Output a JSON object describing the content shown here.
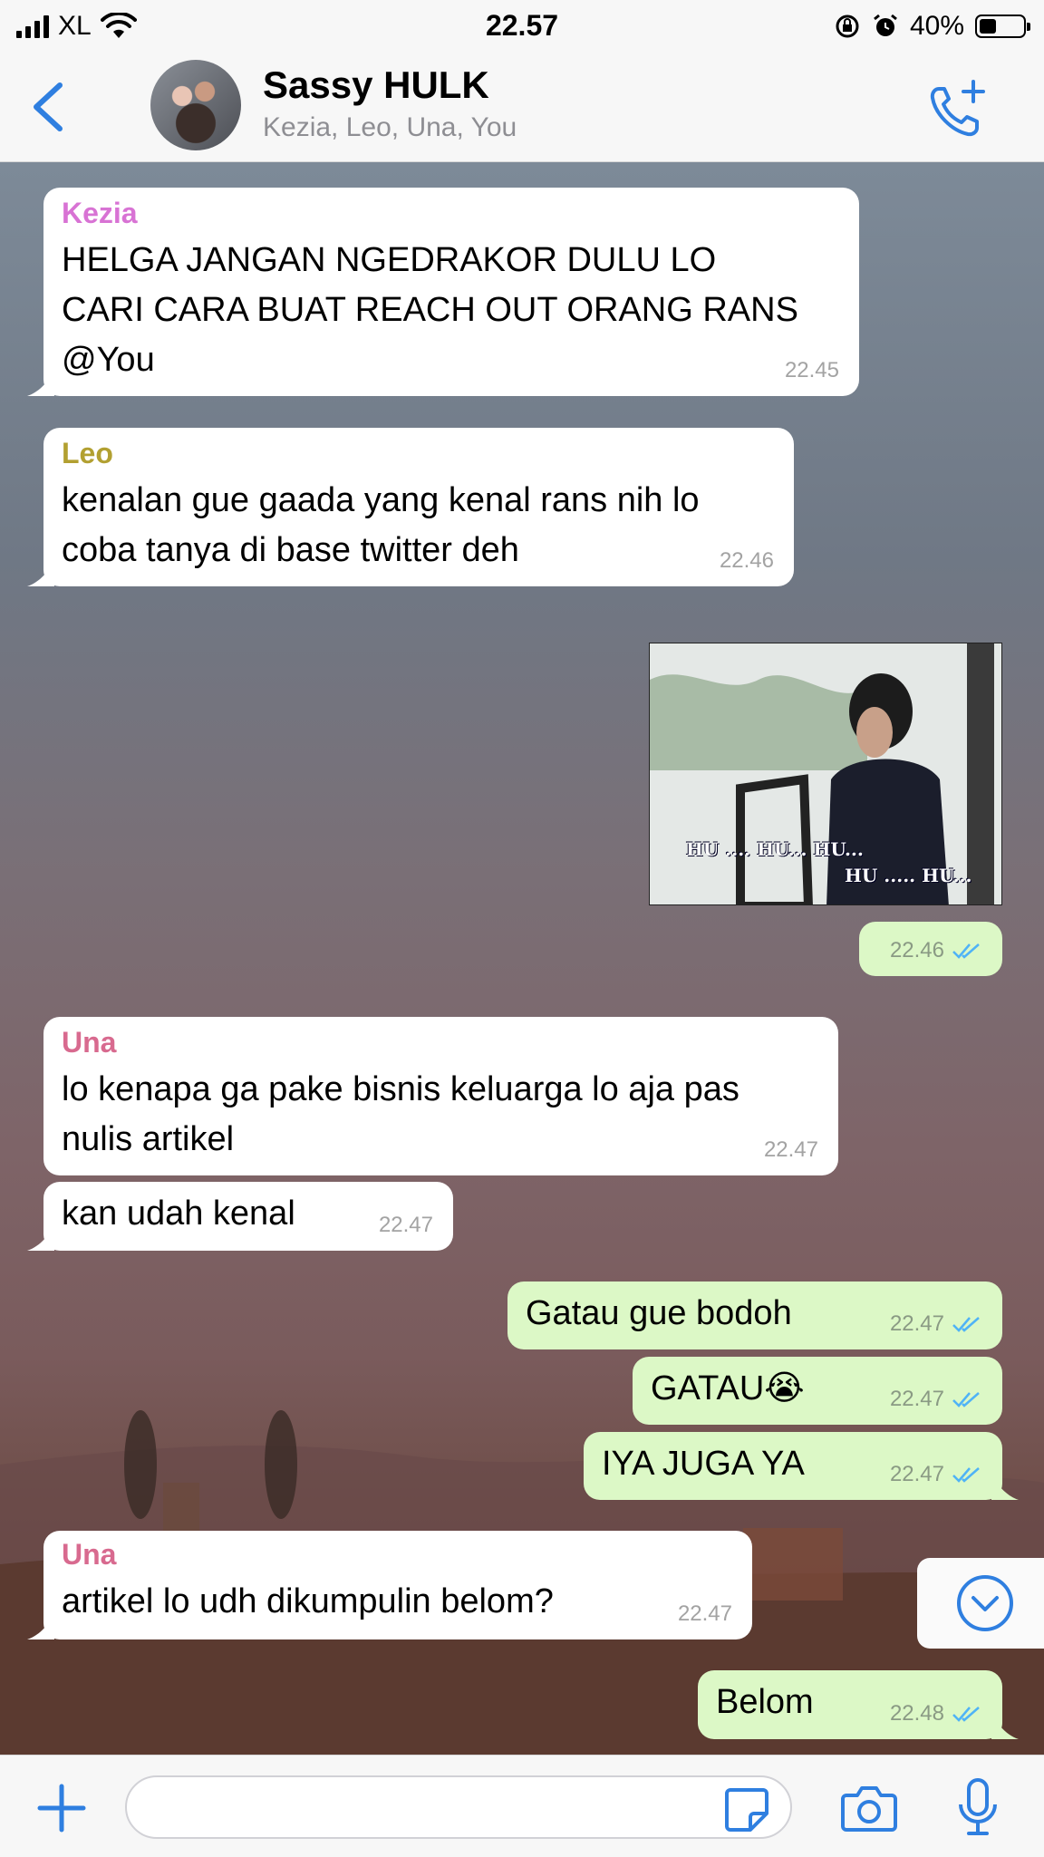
{
  "status_bar": {
    "carrier": "XL",
    "time": "22.57",
    "battery_percent": "40%",
    "battery_level": 0.4,
    "icons": [
      "signal-icon",
      "wifi-icon",
      "rotation-lock-icon",
      "alarm-icon",
      "battery-icon"
    ]
  },
  "header": {
    "title": "Sassy HULK",
    "subtitle": "Kezia, Leo, Una, You",
    "icons": [
      "back-chevron-icon",
      "group-avatar",
      "add-call-icon"
    ]
  },
  "messages": [
    {
      "sender": "Kezia",
      "sender_color": "#d873d4",
      "lines": [
        "HELGA JANGAN NGEDRAKOR DULU LO",
        "CARI CARA BUAT REACH OUT ORANG RANS",
        "@You"
      ],
      "time": "22.45"
    },
    {
      "sender": "Leo",
      "sender_color": "#b2a031",
      "lines": [
        "kenalan gue gaada yang kenal rans nih lo",
        "coba tanya di base twitter deh"
      ],
      "time": "22.46"
    },
    {
      "image_caption_1": "HU .... HU... HU...",
      "image_caption_2": "HU ..... HU...",
      "time": "22.46"
    },
    {
      "sender": "Una",
      "sender_color": "#d86a8f",
      "lines": [
        "lo kenapa ga pake bisnis keluarga lo aja pas",
        "nulis artikel"
      ],
      "time": "22.47"
    },
    {
      "lines": [
        "kan udah kenal"
      ],
      "time": "22.47"
    },
    {
      "lines": [
        "Gatau gue bodoh"
      ],
      "time": "22.47"
    },
    {
      "lines": [
        "GATAU😭"
      ],
      "time": "22.47"
    },
    {
      "lines": [
        "IYA JUGA YA"
      ],
      "time": "22.47"
    },
    {
      "sender": "Una",
      "sender_color": "#d86a8f",
      "lines": [
        "artikel lo udh dikumpulin belom?"
      ],
      "time": "22.47"
    },
    {
      "lines": [
        "Belom"
      ],
      "time": "22.48"
    }
  ],
  "colors": {
    "accent": "#2f7fe0",
    "outgoing_bubble": "#dcf8c6",
    "incoming_bubble": "#ffffff",
    "read_ticks": "#4fb3f6"
  },
  "input_bar": {
    "value": "",
    "icons": [
      "plus-icon",
      "sticker-icon",
      "camera-icon",
      "microphone-icon"
    ]
  },
  "scroll_button_icon": "chevron-down-circle-icon"
}
